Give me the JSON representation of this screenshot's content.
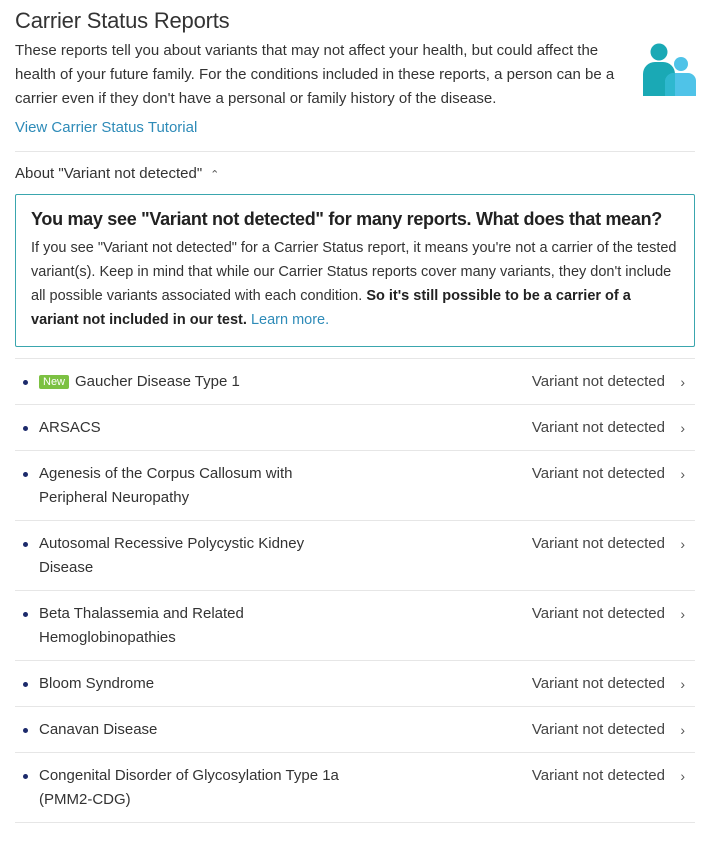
{
  "header": {
    "title": "Carrier Status Reports",
    "intro": "These reports tell you about variants that may not affect your health, but could affect the health of your future family. For the conditions included in these reports, a person can be a carrier even if they don't have a personal or family history of the disease.",
    "tutorial_link": "View Carrier Status Tutorial",
    "icon": "family-icon"
  },
  "about": {
    "toggle_label": "About \"Variant not detected\"",
    "toggle_icon": "chevron-up-icon",
    "box_title": "You may see \"Variant not detected\" for many reports. What does that mean?",
    "body_plain": "If you see \"Variant not detected\" for a Carrier Status report, it means you're not a carrier of the tested variant(s). Keep in mind that while our Carrier Status reports cover many variants, they don't include all possible variants associated with each condition. ",
    "body_bold": "So it's still possible to be a carrier of a variant not included in our test.",
    "learn_more": "Learn more."
  },
  "colors": {
    "link": "#2e8bb8",
    "box_border": "#3aa6ae",
    "badge_new": "#7cc142",
    "bullet": "#1c2a6b",
    "icon_teal": "#1aa9b5",
    "icon_light": "#4fc3e8"
  },
  "reports": [
    {
      "name": "Gaucher Disease Type 1",
      "badge": "New",
      "status": "Variant not detected"
    },
    {
      "name": "ARSACS",
      "status": "Variant not detected"
    },
    {
      "name": "Agenesis of the Corpus Callosum with Peripheral Neuropathy",
      "status": "Variant not detected"
    },
    {
      "name": "Autosomal Recessive Polycystic Kidney Disease",
      "status": "Variant not detected"
    },
    {
      "name": "Beta Thalassemia and Related Hemoglobinopathies",
      "status": "Variant not detected"
    },
    {
      "name": "Bloom Syndrome",
      "status": "Variant not detected"
    },
    {
      "name": "Canavan Disease",
      "status": "Variant not detected"
    },
    {
      "name": "Congenital Disorder of Glycosylation Type 1a (PMM2-CDG)",
      "status": "Variant not detected"
    }
  ]
}
